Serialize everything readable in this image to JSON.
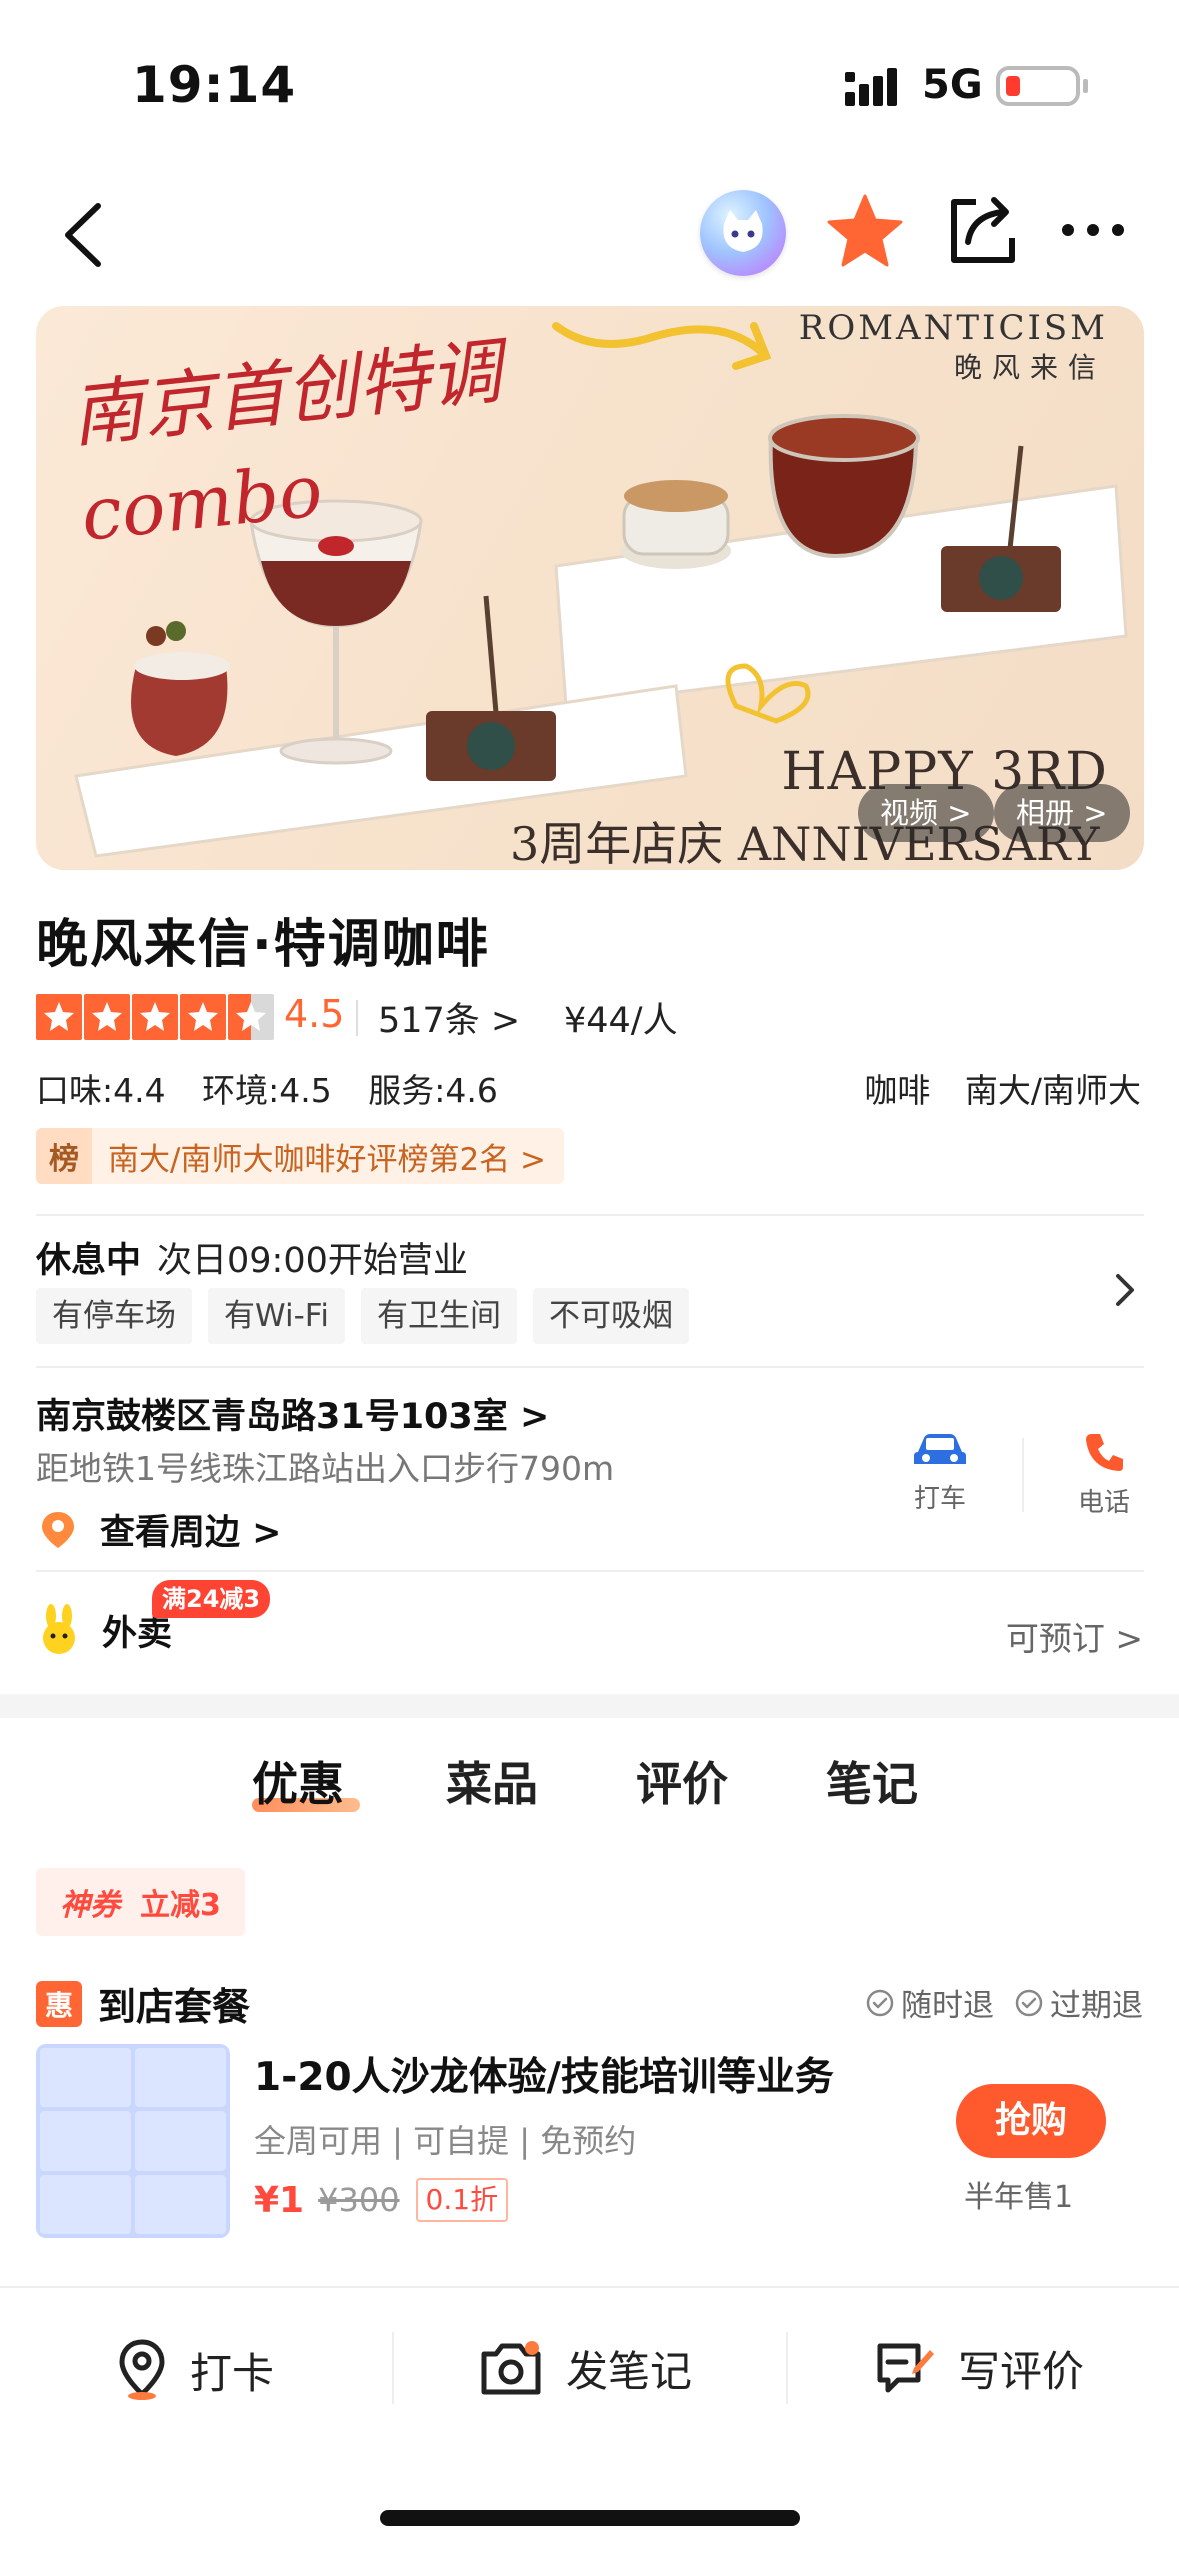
{
  "status_bar": {
    "time": "19:14",
    "network": "5G"
  },
  "nav": {
    "icons": [
      "back-icon",
      "ai-assistant-icon",
      "star-icon",
      "share-icon",
      "more-icon"
    ],
    "colors": {
      "favorite": "#ff6633"
    }
  },
  "banner": {
    "brand_en": "ROMANTICISM",
    "brand_cn": "晚风来信",
    "tagline": "南京首创特调combo",
    "happy": "HAPPY 3RD",
    "anniversary": "3周年店庆 ANNIVERSARY",
    "video_label": "视频 >",
    "album_label": "相册 >"
  },
  "shop": {
    "name": "晚风来信·特调咖啡",
    "score": "4.5",
    "reviews": "517条 >",
    "price": "¥44/人",
    "sub_scores": {
      "taste": "口味:4.4",
      "environment": "环境:4.5",
      "service": "服务:4.6"
    },
    "category": "咖啡",
    "area": "南大/南师大",
    "rank_badge": "榜",
    "rank_text": "南大/南师大咖啡好评榜第2名 >"
  },
  "hours": {
    "status": "休息中",
    "next_open": "次日09:00开始营业"
  },
  "facilities": [
    "有停车场",
    "有Wi-Fi",
    "有卫生间",
    "不可吸烟"
  ],
  "location": {
    "address": "南京鼓楼区青岛路31号103室 >",
    "metro": "距地铁1号线珠江路站出入口步行790m",
    "nearby": "查看周边 >",
    "taxi_label": "打车",
    "phone_label": "电话"
  },
  "delivery": {
    "label": "外卖",
    "promo": "满24减3",
    "reserve": "可预订 >"
  },
  "tabs": [
    {
      "label": "优惠",
      "active": true
    },
    {
      "label": "菜品",
      "active": false
    },
    {
      "label": "评价",
      "active": false
    },
    {
      "label": "笔记",
      "active": false
    }
  ],
  "coupon": {
    "brand": "神券",
    "text": "立减3"
  },
  "package": {
    "badge": "惠",
    "title": "到店套餐",
    "guarantees": [
      "随时退",
      "过期退"
    ]
  },
  "deal": {
    "title": "1-20人沙龙体验/技能培训等业务",
    "subtitle": "全周可用 | 可自提 | 免预约",
    "price_now": "¥1",
    "price_old": "¥300",
    "discount": "0.1折",
    "buy_label": "抢购",
    "sold": "半年售1"
  },
  "bottom_bar": {
    "checkin": "打卡",
    "post_note": "发笔记",
    "write_review": "写评价"
  }
}
